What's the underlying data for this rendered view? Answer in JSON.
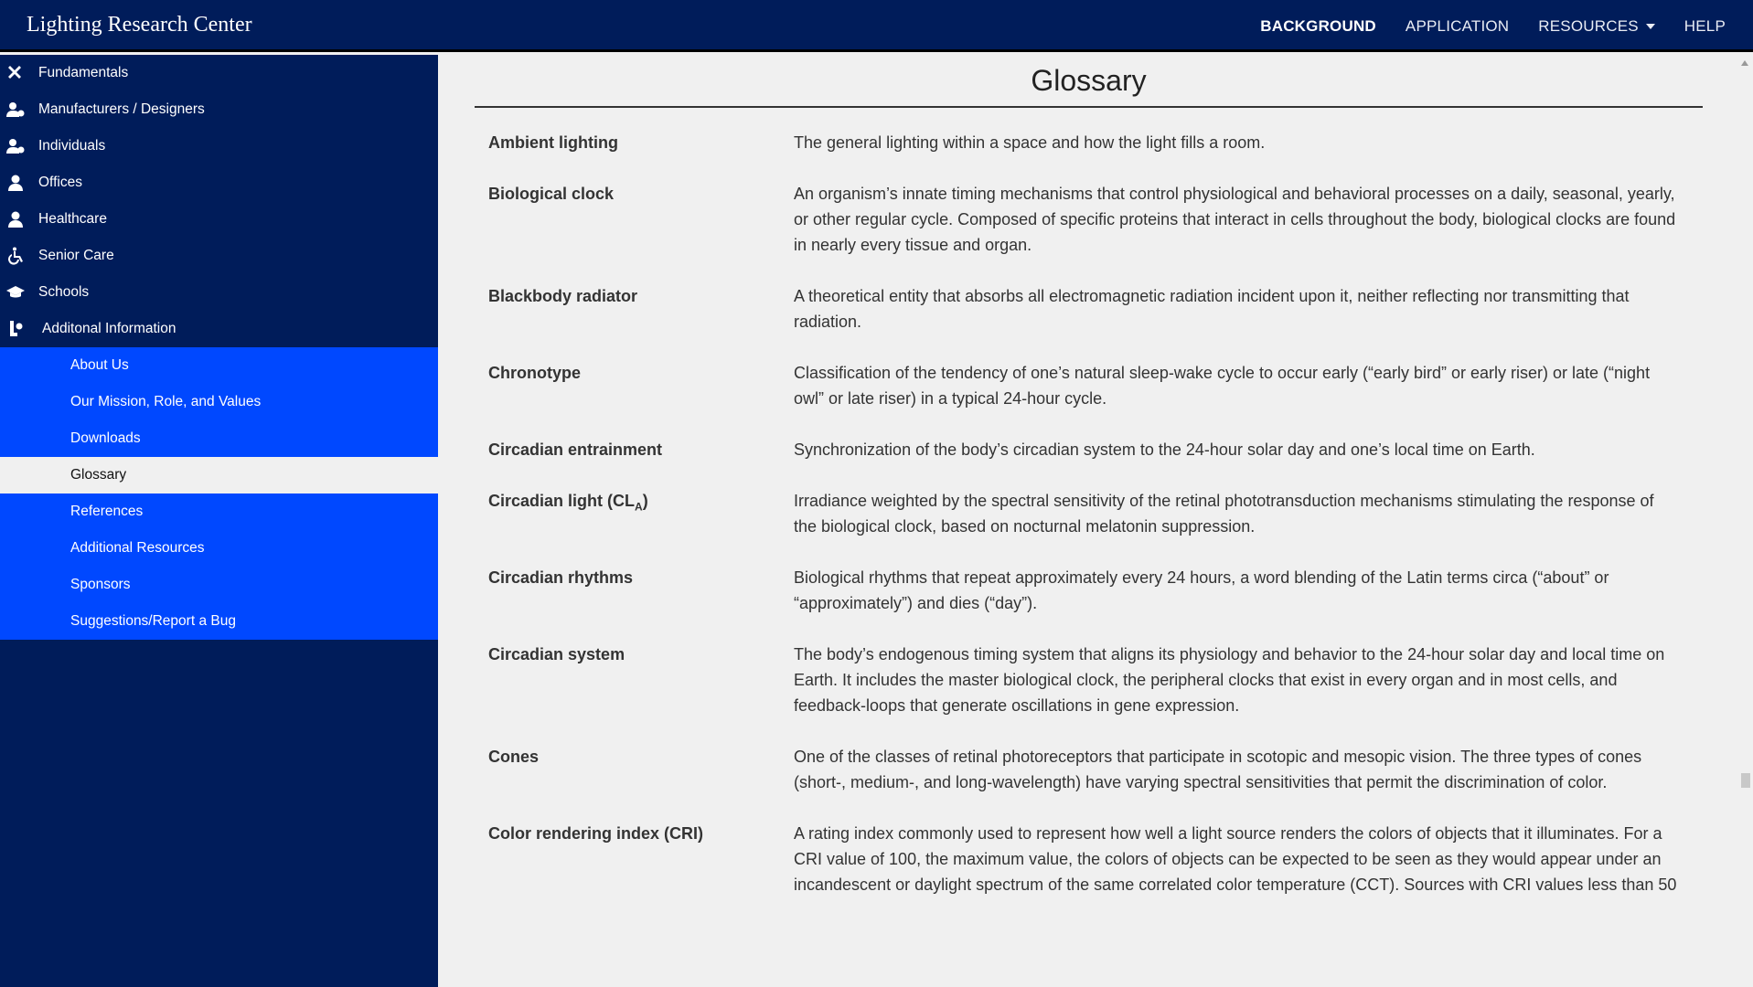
{
  "header": {
    "brand": "Lighting Research Center",
    "nav": [
      {
        "label": "BACKGROUND"
      },
      {
        "label": "APPLICATION"
      },
      {
        "label": "RESOURCES"
      },
      {
        "label": "HELP"
      }
    ]
  },
  "sidebar": {
    "items": [
      {
        "label": "Fundamentals",
        "icon": "tools-icon"
      },
      {
        "label": "Manufacturers / Designers",
        "icon": "user-gear-icon"
      },
      {
        "label": "Individuals",
        "icon": "user-gear-icon"
      },
      {
        "label": "Offices",
        "icon": "user-icon"
      },
      {
        "label": "Healthcare",
        "icon": "user-icon"
      },
      {
        "label": "Senior Care",
        "icon": "wheelchair-icon"
      },
      {
        "label": "Schools",
        "icon": "graduation-cap-icon"
      },
      {
        "label": "Additonal Information",
        "icon": "info-person-icon"
      }
    ],
    "subitems": [
      {
        "label": "About Us"
      },
      {
        "label": "Our Mission, Role, and Values"
      },
      {
        "label": "Downloads"
      },
      {
        "label": "Glossary"
      },
      {
        "label": "References"
      },
      {
        "label": "Additional Resources"
      },
      {
        "label": "Sponsors"
      },
      {
        "label": "Suggestions/Report a Bug"
      }
    ]
  },
  "main": {
    "title": "Glossary",
    "entries": [
      {
        "term": "Ambient lighting",
        "definition": "The general lighting within a space and how the light fills a room."
      },
      {
        "term": "Biological clock",
        "definition": "An organism’s innate timing mechanisms that control physiological and behavioral processes on a daily, seasonal, yearly, or other regular cycle. Composed of specific proteins that interact in cells throughout the body, biological clocks are found in nearly every tissue and organ."
      },
      {
        "term": "Blackbody radiator",
        "definition": "A theoretical entity that absorbs all electromagnetic radiation incident upon it, neither reflecting nor transmitting that radiation."
      },
      {
        "term": "Chronotype",
        "definition": "Classification of the tendency of one’s natural sleep-wake cycle to occur early (“early bird” or early riser) or late (“night owl” or late riser) in a typical 24-hour cycle."
      },
      {
        "term": "Circadian entrainment",
        "definition": "Synchronization of the body’s circadian system to the 24-hour solar day and one’s local time on Earth."
      },
      {
        "term": "Circadian light (CL",
        "term_sub": "A",
        "term_end": ")",
        "definition": "Irradiance weighted by the spectral sensitivity of the retinal phototransduction mechanisms stimulating the response of the biological clock, based on nocturnal melatonin suppression."
      },
      {
        "term": "Circadian rhythms",
        "definition": "Biological rhythms that repeat approximately every 24 hours, a word blending of the Latin terms circa (“about” or “approximately”) and dies (“day”)."
      },
      {
        "term": "Circadian system",
        "definition": "The body’s endogenous timing system that aligns its physiology and behavior to the 24-hour solar day and local time on Earth. It includes the master biological clock, the peripheral clocks that exist in every organ and in most cells, and feedback-loops that generate oscillations in gene expression."
      },
      {
        "term": "Cones",
        "definition": "One of the classes of retinal photoreceptors that participate in scotopic and mesopic vision. The three types of cones (short-, medium-, and long-wavelength) have varying spectral sensitivities that permit the discrimination of color."
      },
      {
        "term": "Color rendering index (CRI)",
        "definition": "A rating index commonly used to represent how well a light source renders the colors of objects that it illuminates. For a CRI value of 100, the maximum value, the colors of objects can be expected to be seen as they would appear under an incandescent or daylight spectrum of the same correlated color temperature (CCT). Sources with CRI values less than 50"
      }
    ]
  },
  "colors": {
    "navy": "#001c5a",
    "accent_blue": "#0048ff",
    "page_bg": "#f0f0f0"
  }
}
